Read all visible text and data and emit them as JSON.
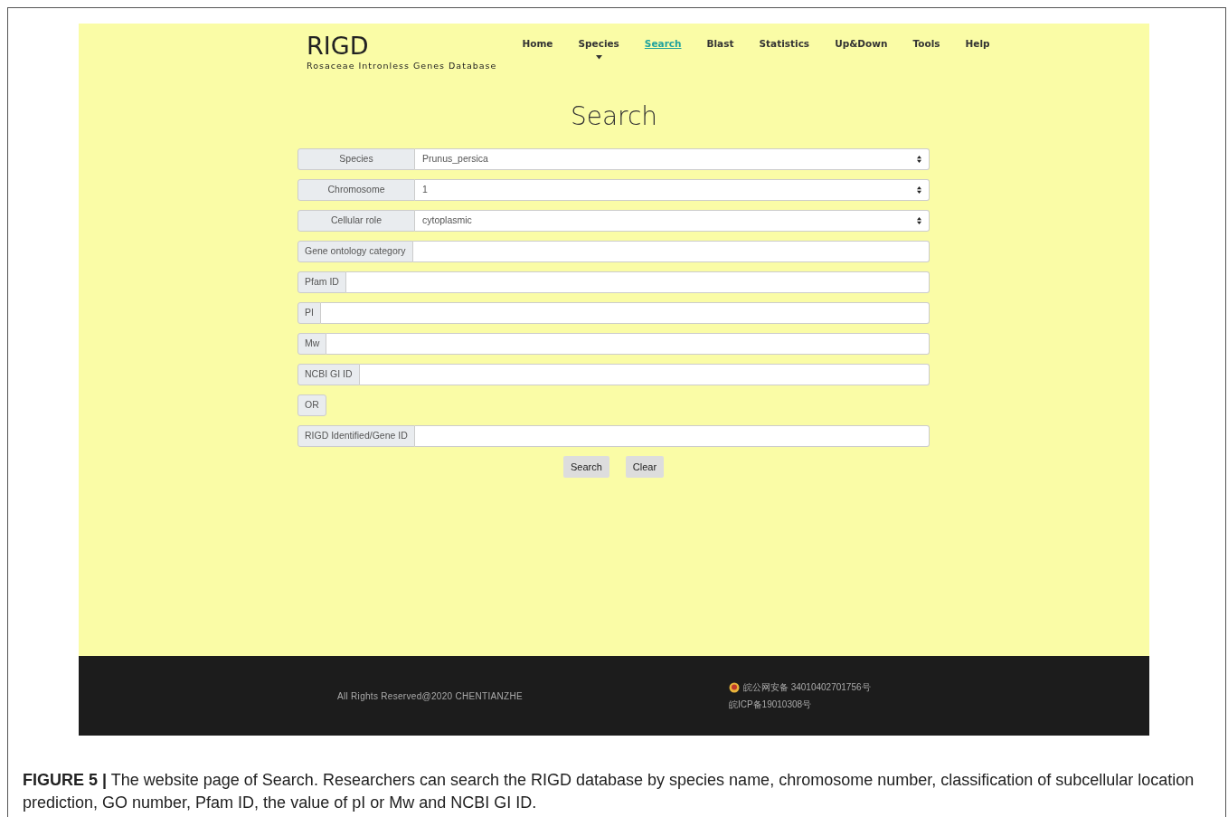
{
  "site": {
    "title": "RIGD",
    "subtitle": "Rosaceae Intronless Genes Database"
  },
  "nav": [
    {
      "label": "Home",
      "selected": false,
      "dropdown": false
    },
    {
      "label": "Species",
      "selected": false,
      "dropdown": true
    },
    {
      "label": "Search",
      "selected": true,
      "dropdown": false
    },
    {
      "label": "Blast",
      "selected": false,
      "dropdown": false
    },
    {
      "label": "Statistics",
      "selected": false,
      "dropdown": false
    },
    {
      "label": "Up&Down",
      "selected": false,
      "dropdown": false
    },
    {
      "label": "Tools",
      "selected": false,
      "dropdown": false
    },
    {
      "label": "Help",
      "selected": false,
      "dropdown": false
    }
  ],
  "heading": "Search",
  "fields": [
    {
      "kind": "select",
      "label": "Species",
      "value": "Prunus_persica"
    },
    {
      "kind": "select",
      "label": "Chromosome",
      "value": "1"
    },
    {
      "kind": "select",
      "label": "Cellular role",
      "value": "cytoplasmic"
    },
    {
      "kind": "input",
      "label": "Gene ontology category"
    },
    {
      "kind": "input",
      "label": "Pfam ID"
    },
    {
      "kind": "input",
      "label": "PI"
    },
    {
      "kind": "input",
      "label": "Mw"
    },
    {
      "kind": "input",
      "label": "NCBI GI ID"
    },
    {
      "kind": "separator",
      "label": "OR"
    },
    {
      "kind": "input",
      "label": "RIGD Identified/Gene ID"
    }
  ],
  "buttons": [
    "Search",
    "Clear"
  ],
  "footer": {
    "copyright": "All Rights Reserved@2020 CHENTIANZHE",
    "police_record": "皖公网安备 34010402701756号",
    "icp_record": "皖ICP备19010308号"
  },
  "caption": "**FIGURE 5 |** The website page of Search. Researchers can search the RIGD database by species name, chromosome number, classification of subcellular location prediction, GO number, Pfam ID, the value of pI or Mw and NCBI GI ID."
}
